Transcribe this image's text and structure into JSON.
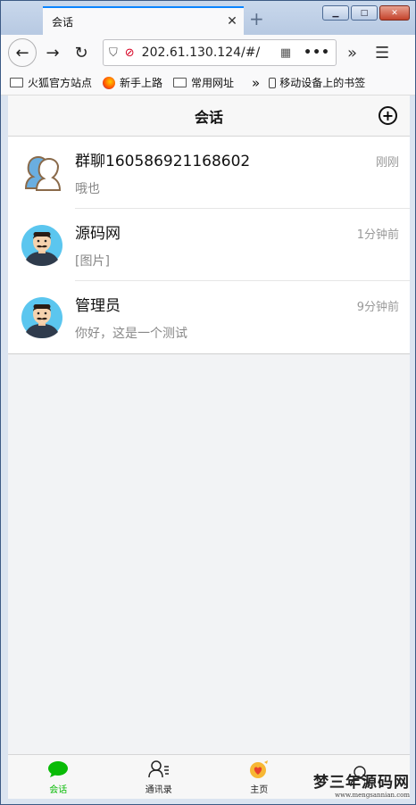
{
  "browser": {
    "tab_title": "会话",
    "tab_close": "✕",
    "new_tab": "+",
    "url": "202.61.130.124/#/",
    "bookmarks": [
      {
        "label": "火狐官方站点",
        "icon": "folder-icon"
      },
      {
        "label": "新手上路",
        "icon": "firefox-icon"
      },
      {
        "label": "常用网址",
        "icon": "folder-icon"
      }
    ],
    "mobile_bookmarks": "移动设备上的书签"
  },
  "header": {
    "title": "会话",
    "add_icon": "plus-circle-icon"
  },
  "conversations": [
    {
      "name": "群聊160586921168602",
      "time": "刚刚",
      "message": "哦也",
      "avatar": "group-avatar"
    },
    {
      "name": "源码网",
      "time": "1分钟前",
      "message": "[图片]",
      "avatar": "user-avatar"
    },
    {
      "name": "管理员",
      "time": "9分钟前",
      "message": "你好，这是一个测试",
      "avatar": "user-avatar"
    }
  ],
  "tabbar": {
    "items": [
      {
        "label": "会话",
        "icon": "chat-bubble-icon",
        "active": true
      },
      {
        "label": "通讯录",
        "icon": "contacts-icon",
        "active": false
      },
      {
        "label": "主页",
        "icon": "home-heart-icon",
        "active": false
      },
      {
        "label": "",
        "icon": "profile-icon",
        "active": false
      }
    ]
  },
  "colors": {
    "accent": "#09bb07",
    "firefox_tab_highlight": "#0a84ff"
  },
  "watermark": {
    "main": "梦三年源码网",
    "sub": "www.mengsannian.com"
  }
}
